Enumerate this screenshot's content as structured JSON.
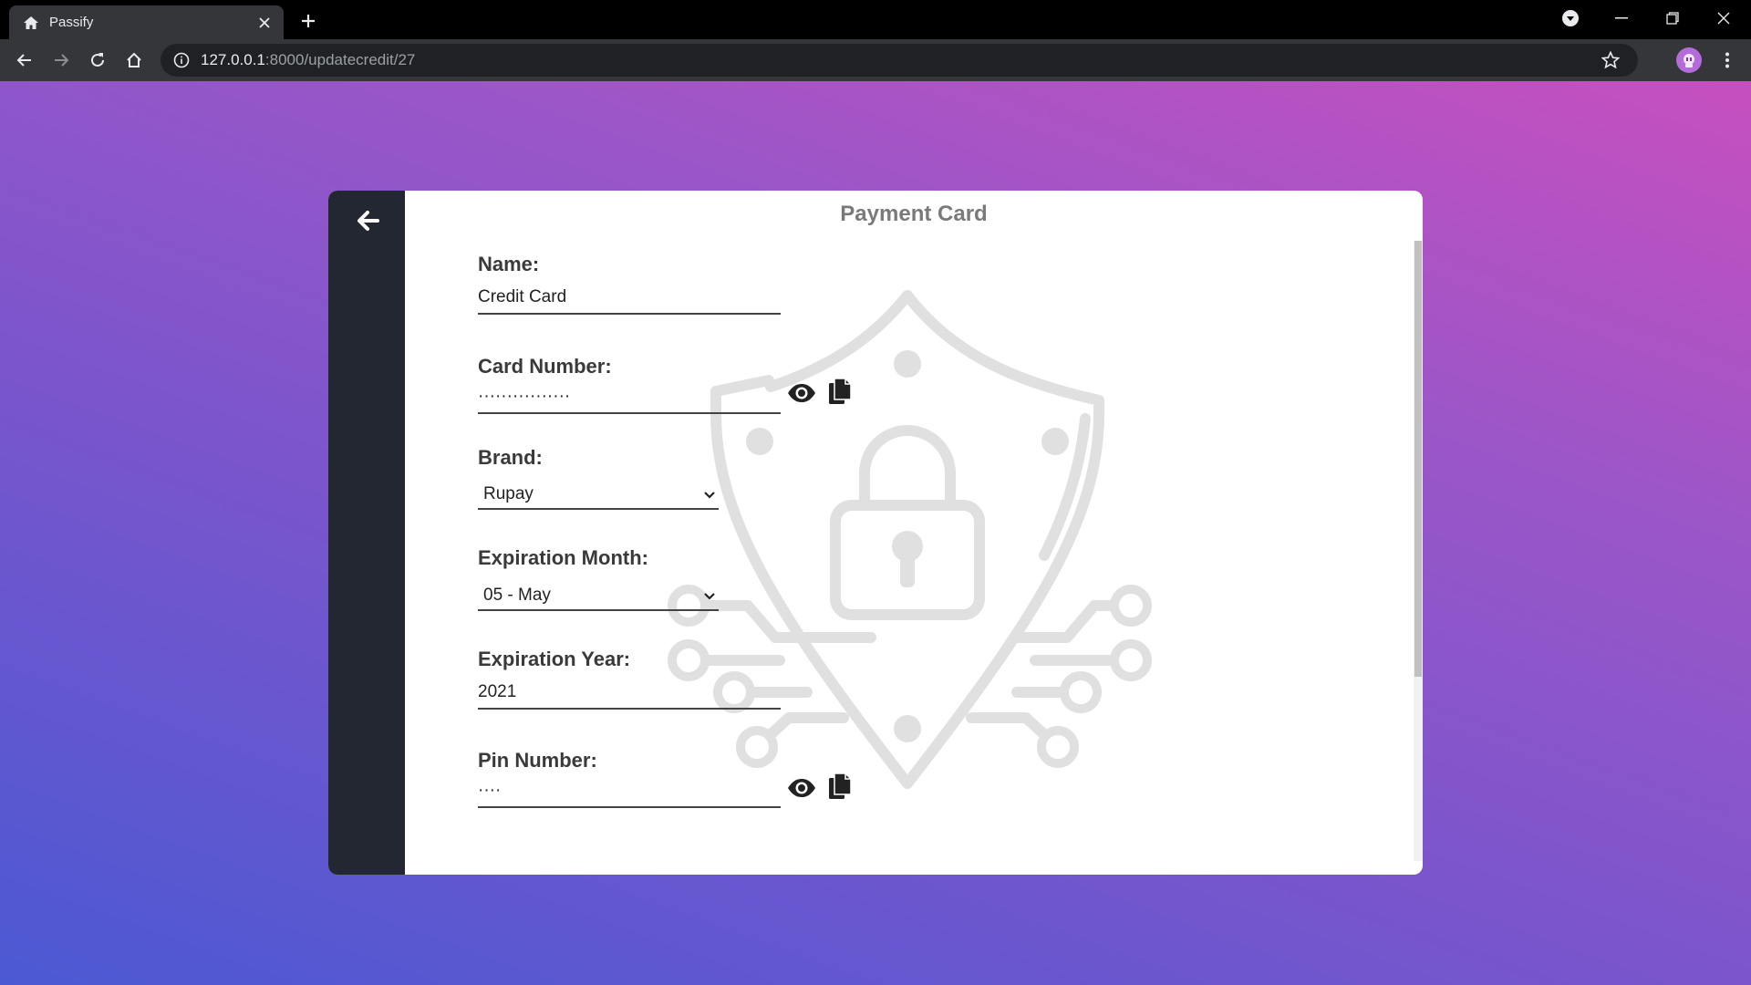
{
  "browser": {
    "tab_title": "Passify",
    "url_host": "127.0.0.1",
    "url_rest": ":8000/updatecredit/27"
  },
  "page": {
    "title": "Payment Card",
    "fields": {
      "name": {
        "label": "Name:",
        "value": "Credit Card"
      },
      "card_number": {
        "label": "Card Number:",
        "value": "················"
      },
      "brand": {
        "label": "Brand:",
        "value": "Rupay"
      },
      "exp_month": {
        "label": "Expiration Month:",
        "value": "05 - May"
      },
      "exp_year": {
        "label": "Expiration Year:",
        "value": "2021"
      },
      "pin": {
        "label": "Pin Number:",
        "value": "····"
      }
    }
  },
  "colors": {
    "sidebar": "#222731",
    "gradient_top": "#c74fbf",
    "gradient_bottom": "#4b59d3"
  }
}
